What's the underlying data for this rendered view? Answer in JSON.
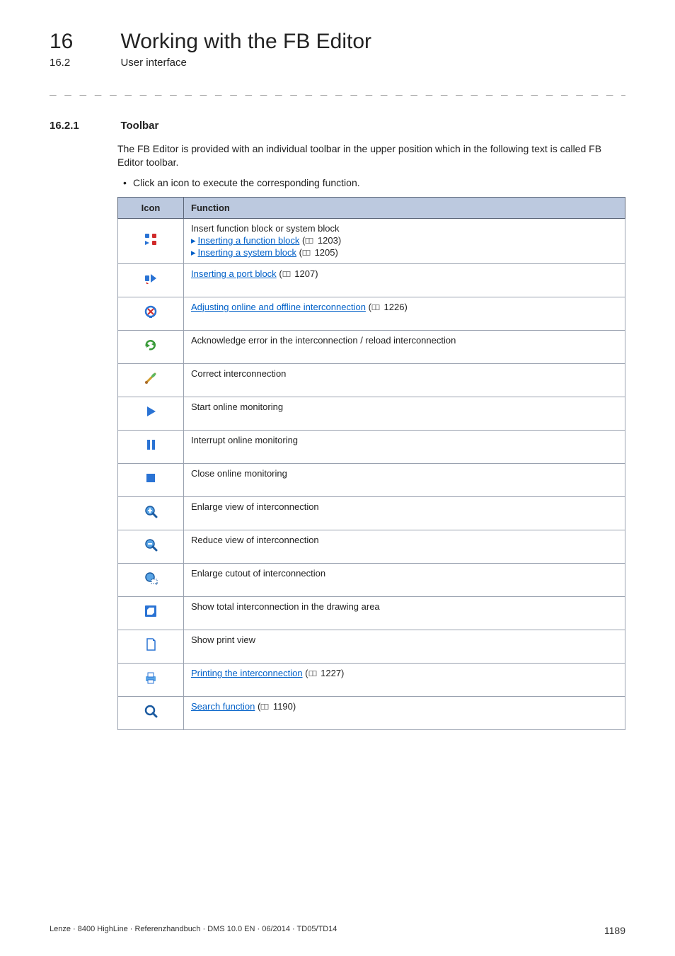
{
  "header": {
    "chapter_number": "16",
    "chapter_title": "Working with the FB Editor",
    "section_number": "16.2",
    "section_title": "User interface",
    "dash_rule": "_ _ _ _ _ _ _ _ _ _ _ _ _ _ _ _ _ _ _ _ _ _ _ _ _ _ _ _ _ _ _ _ _ _ _ _ _ _ _ _ _ _ _ _ _ _ _ _ _ _ _ _ _ _ _ _ _ _ _ _ _ _ _ _"
  },
  "section": {
    "number": "16.2.1",
    "title": "Toolbar",
    "intro": "The FB Editor is provided with an individual toolbar in the upper position which in the following text is called FB Editor toolbar.",
    "bullet": "Click an icon to execute the corresponding function."
  },
  "table": {
    "head_icon": "Icon",
    "head_function": "Function",
    "rows": [
      {
        "icon_name": "insert-block-icon",
        "lines": [
          {
            "plain": "Insert function block or system block"
          },
          {
            "arrow": true,
            "link": "Inserting a function block",
            "ref": "1203"
          },
          {
            "arrow": true,
            "link": "Inserting a system block",
            "ref": "1205"
          }
        ]
      },
      {
        "icon_name": "insert-port-icon",
        "lines": [
          {
            "link": "Inserting a port block",
            "ref": "1207"
          }
        ]
      },
      {
        "icon_name": "adjust-online-icon",
        "lines": [
          {
            "link": "Adjusting online and offline interconnection",
            "ref": "1226"
          }
        ]
      },
      {
        "icon_name": "ack-reload-icon",
        "lines": [
          {
            "plain": "Acknowledge error in the interconnection / reload interconnection"
          }
        ]
      },
      {
        "icon_name": "correct-icon",
        "lines": [
          {
            "plain": "Correct interconnection"
          }
        ]
      },
      {
        "icon_name": "start-monitor-icon",
        "lines": [
          {
            "plain": "Start online monitoring"
          }
        ]
      },
      {
        "icon_name": "interrupt-monitor-icon",
        "lines": [
          {
            "plain": "Interrupt online monitoring"
          }
        ]
      },
      {
        "icon_name": "close-monitor-icon",
        "lines": [
          {
            "plain": "Close online monitoring"
          }
        ]
      },
      {
        "icon_name": "zoom-in-icon",
        "lines": [
          {
            "plain": "Enlarge view of interconnection"
          }
        ]
      },
      {
        "icon_name": "zoom-out-icon",
        "lines": [
          {
            "plain": "Reduce view of interconnection"
          }
        ]
      },
      {
        "icon_name": "zoom-region-icon",
        "lines": [
          {
            "plain": "Enlarge cutout of interconnection"
          }
        ]
      },
      {
        "icon_name": "fit-all-icon",
        "lines": [
          {
            "plain": "Show total interconnection in the drawing area"
          }
        ]
      },
      {
        "icon_name": "print-view-icon",
        "lines": [
          {
            "plain": "Show print view"
          }
        ]
      },
      {
        "icon_name": "print-icon",
        "lines": [
          {
            "link": "Printing the interconnection",
            "ref": "1227"
          }
        ]
      },
      {
        "icon_name": "search-icon",
        "lines": [
          {
            "link": "Search function",
            "ref": "1190"
          }
        ]
      }
    ]
  },
  "footer": {
    "left": "Lenze · 8400 HighLine · Referenzhandbuch · DMS 10.0 EN · 06/2014 · TD05/TD14",
    "page": "1189"
  }
}
